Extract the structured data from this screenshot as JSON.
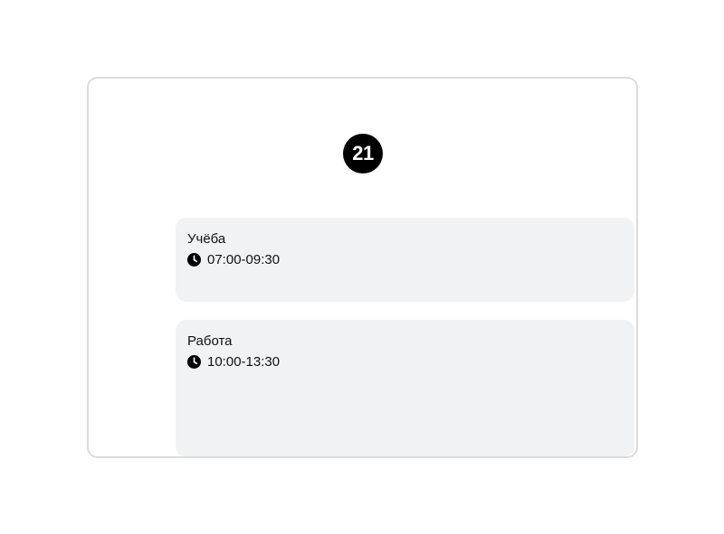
{
  "calendar": {
    "day_number": "21",
    "events": [
      {
        "title": "Учёба",
        "time": "07:00-09:30",
        "icon": "clock-icon"
      },
      {
        "title": "Работа",
        "time": "10:00-13:30",
        "icon": "clock-icon"
      }
    ]
  },
  "colors": {
    "badge_bg": "#000000",
    "badge_text": "#ffffff",
    "event_bg": "#f1f2f4",
    "frame_border": "#dcdcdc"
  }
}
